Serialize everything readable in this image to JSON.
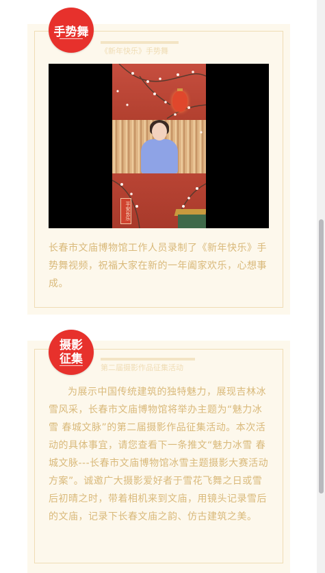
{
  "section1": {
    "badge": "手势舞",
    "subtitle": "《新年快乐》手势舞",
    "video": {
      "stamp_text": "平安长乐"
    },
    "description": "长春市文庙博物馆工作人员录制了《新年快乐》手势舞视频，祝福大家在新的一年阖家欢乐，心想事成。"
  },
  "section2": {
    "badge_line1": "摄影",
    "badge_line2": "征集",
    "subtitle": "第二届摄影作品征集活动",
    "description": "为展示中国传统建筑的独特魅力，展现吉林冰雪风采，长春市文庙博物馆将举办主题为“魅力冰雪 春城文脉”的第二届摄影作品征集活动。本次活动的具体事宜，请您查看下一条推文“魅力冰雪 春城文脉---长春市文庙博物馆冰雪主题摄影大赛活动方案”。诚邀广大摄影爱好者于雪花飞舞之日或雪后初晴之时，带着相机来到文庙，用镜头记录雪后的文庙，记录下长春文庙之韵、仿古建筑之美。"
  },
  "colors": {
    "badge_red": "#e7312c",
    "card_bg": "#fdf8ec",
    "text_gold": "#d9b97a",
    "border": "#efdcb4"
  }
}
